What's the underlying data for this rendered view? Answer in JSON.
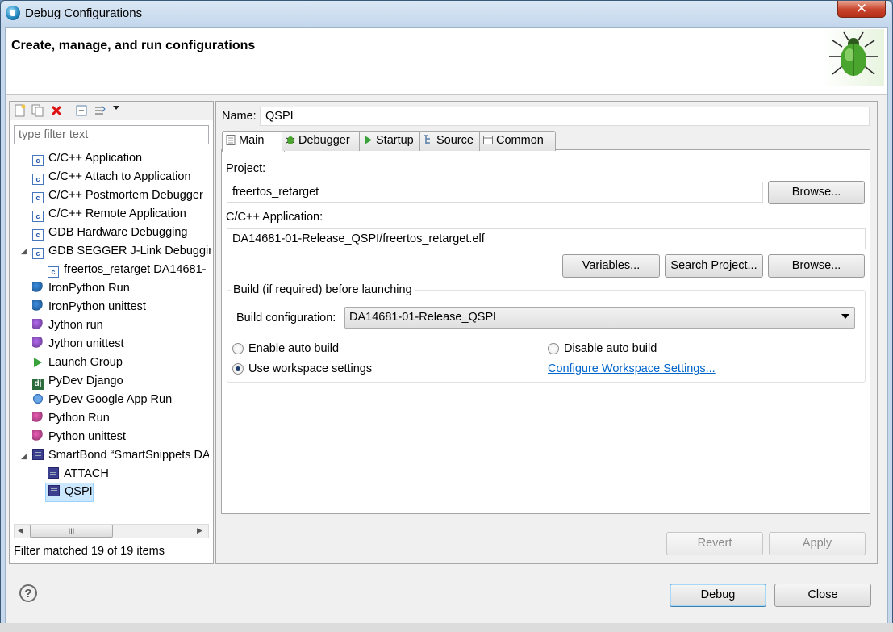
{
  "window": {
    "title": "Debug Configurations",
    "close_glyph": "✕"
  },
  "banner": {
    "title": "Create, manage, and run configurations"
  },
  "left": {
    "filter_placeholder": "type filter text",
    "tree": [
      {
        "label": "C/C++ Application",
        "icon": "c-app-icon"
      },
      {
        "label": "C/C++ Attach to Application",
        "icon": "c-app-icon"
      },
      {
        "label": "C/C++ Postmortem Debugger",
        "icon": "c-app-icon"
      },
      {
        "label": "C/C++ Remote Application",
        "icon": "c-app-icon"
      },
      {
        "label": "GDB Hardware Debugging",
        "icon": "c-app-icon"
      },
      {
        "label": "GDB SEGGER J-Link Debuggin",
        "icon": "c-app-icon"
      },
      {
        "label": "freertos_retarget DA14681-",
        "icon": "c-app-icon"
      },
      {
        "label": "IronPython Run",
        "icon": "ironpython-icon"
      },
      {
        "label": "IronPython unittest",
        "icon": "ironpython-unittest-icon"
      },
      {
        "label": "Jython run",
        "icon": "jython-icon"
      },
      {
        "label": "Jython unittest",
        "icon": "jython-unittest-icon"
      },
      {
        "label": "Launch Group",
        "icon": "launch-group-icon"
      },
      {
        "label": "PyDev Django",
        "icon": "django-icon"
      },
      {
        "label": "PyDev Google App Run",
        "icon": "google-app-icon"
      },
      {
        "label": "Python Run",
        "icon": "python-icon"
      },
      {
        "label": "Python unittest",
        "icon": "python-unittest-icon"
      },
      {
        "label": "SmartBond “SmartSnippets DA",
        "icon": "smartsnippets-icon"
      },
      {
        "label": "ATTACH",
        "icon": "smartsnippets-icon"
      },
      {
        "label": "QSPI",
        "icon": "smartsnippets-icon"
      }
    ],
    "scroll_grip": "III",
    "filter_status": "Filter matched 19 of 19 items"
  },
  "right": {
    "name_label": "Name:",
    "name_value": "QSPI",
    "tabs": [
      {
        "label": "Main",
        "icon": "main-tab-icon"
      },
      {
        "label": "Debugger",
        "icon": "debugger-tab-icon"
      },
      {
        "label": "Startup",
        "icon": "startup-tab-icon"
      },
      {
        "label": "Source",
        "icon": "source-tab-icon"
      },
      {
        "label": "Common",
        "icon": "common-tab-icon"
      }
    ],
    "project_label": "Project:",
    "project_value": "freertos_retarget",
    "browse_label": "Browse...",
    "app_label": "C/C++ Application:",
    "app_value": "DA14681-01-Release_QSPI/freertos_retarget.elf",
    "variables_label": "Variables...",
    "search_project_label": "Search Project...",
    "build_group_title": "Build (if required) before launching",
    "build_config_label": "Build configuration:",
    "build_config_value": "DA14681-01-Release_QSPI",
    "enable_auto_build": "Enable auto build",
    "disable_auto_build": "Disable auto build",
    "use_workspace": "Use workspace settings",
    "configure_link": "Configure Workspace Settings...",
    "selected_radio": "use_workspace",
    "revert_label": "Revert",
    "apply_label": "Apply"
  },
  "footer": {
    "help_glyph": "?",
    "debug_label": "Debug",
    "close_label": "Close"
  },
  "colors": {
    "link": "#0066cc",
    "selection": "#cce8ff",
    "titlebar": "#c2d6ec"
  }
}
